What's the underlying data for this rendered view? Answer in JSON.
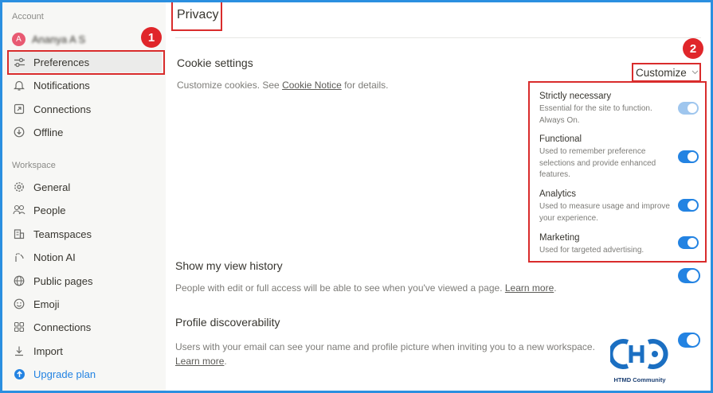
{
  "sidebar": {
    "account_label": "Account",
    "workspace_label": "Workspace",
    "user": {
      "avatar_letter": "A",
      "name": "Ananya A S"
    },
    "account_items": [
      {
        "label": "Preferences",
        "icon": "sliders-icon"
      },
      {
        "label": "Notifications",
        "icon": "bell-icon"
      },
      {
        "label": "Connections",
        "icon": "external-link-icon"
      },
      {
        "label": "Offline",
        "icon": "download-circle-icon"
      }
    ],
    "workspace_items": [
      {
        "label": "General",
        "icon": "gear-icon"
      },
      {
        "label": "People",
        "icon": "people-icon"
      },
      {
        "label": "Teamspaces",
        "icon": "building-icon"
      },
      {
        "label": "Notion AI",
        "icon": "notion-ai-icon"
      },
      {
        "label": "Public pages",
        "icon": "globe-icon"
      },
      {
        "label": "Emoji",
        "icon": "smiley-icon"
      },
      {
        "label": "Connections",
        "icon": "grid-icon"
      },
      {
        "label": "Import",
        "icon": "import-icon"
      }
    ],
    "upgrade_label": "Upgrade plan"
  },
  "main": {
    "title": "Privacy",
    "cookie": {
      "heading": "Cookie settings",
      "desc_pre": "Customize cookies. See ",
      "desc_link": "Cookie Notice",
      "desc_post": " for details.",
      "customize_label": "Customize",
      "categories": [
        {
          "title": "Strictly necessary",
          "desc1": "Essential for the site to function.",
          "desc2": "Always On.",
          "desc3": "",
          "on": true,
          "disabled": true
        },
        {
          "title": "Functional",
          "desc1": "Used to remember preference",
          "desc2": "selections and provide enhanced",
          "desc3": "features.",
          "on": true,
          "disabled": false
        },
        {
          "title": "Analytics",
          "desc1": "Used to measure usage and improve",
          "desc2": "your experience.",
          "desc3": "",
          "on": true,
          "disabled": false
        },
        {
          "title": "Marketing",
          "desc1": "Used for targeted advertising.",
          "desc2": "",
          "desc3": "",
          "on": true,
          "disabled": false
        }
      ]
    },
    "view_history": {
      "heading": "Show my view history",
      "desc_pre": "People with edit or full access will be able to see when you've viewed a page. ",
      "desc_link": "Learn more",
      "desc_post": ".",
      "on": true
    },
    "discoverability": {
      "heading": "Profile discoverability",
      "desc": "Users with your email can see your name and profile picture when inviting you to a new workspace.",
      "desc_link": "Learn more",
      "desc_post": ".",
      "on": true
    }
  },
  "annotations": {
    "badge1": "1",
    "badge2": "2"
  },
  "watermark": {
    "text": "HTMD Community"
  },
  "colors": {
    "accent": "#2383e2",
    "annotation_red": "#d92c2c",
    "frame_blue": "#2b8fe0"
  }
}
